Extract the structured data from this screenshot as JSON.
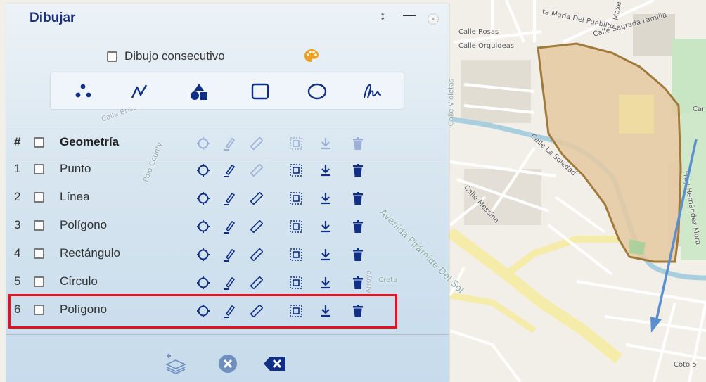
{
  "panel": {
    "title": "Dibujar",
    "consecutive_label": "Dibujo consecutivo"
  },
  "table": {
    "header": {
      "num": "#",
      "name": "Geometría"
    },
    "rows": [
      {
        "num": "1",
        "name": "Punto"
      },
      {
        "num": "2",
        "name": "Línea"
      },
      {
        "num": "3",
        "name": "Polígono"
      },
      {
        "num": "4",
        "name": "Rectángulo"
      },
      {
        "num": "5",
        "name": "Círculo"
      },
      {
        "num": "6",
        "name": "Polígono"
      }
    ]
  },
  "map": {
    "labels": {
      "calle_rosas": "Calle Rosas",
      "calle_orquideas": "Calle Orquideas",
      "calle_sagrada": "Calle Sagrada Familia",
      "maria_pueblito": "ta María Del Pueblito",
      "maxe": "Maxe",
      "la_soledad": "Calle La Soledad",
      "messina": "Calle Messina",
      "piramide": "Avenida Pirámide Del Sol",
      "creta": "Creta",
      "car": "Car",
      "coto": "Coto 5",
      "fray": "Fray Hernández Mora",
      "violetas": "Calle Violetas",
      "county": "Polo County",
      "arroyo": "Arroyo",
      "brisas": "Calle Brisas"
    }
  },
  "colors": {
    "title": "#1a2e7a",
    "icon_blue": "#0f2e84",
    "highlight_border": "#e8101b",
    "polygon_fill": "#e6c9a1",
    "polygon_stroke": "#a07a3a",
    "arrow": "#5b8fce",
    "water": "#a9cfdf"
  }
}
